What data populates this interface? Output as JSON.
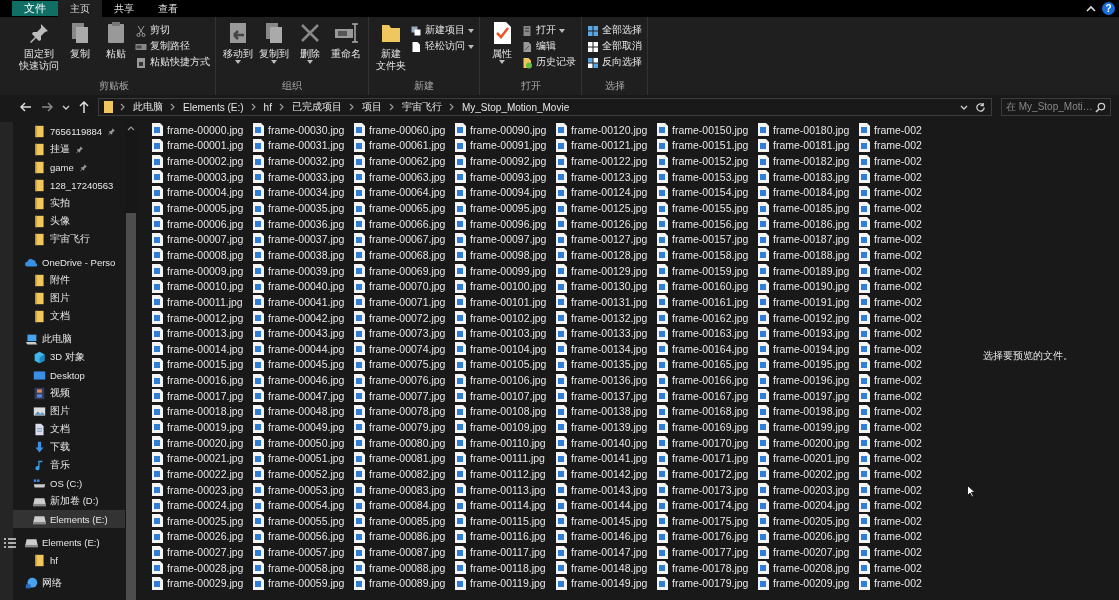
{
  "tabs": [
    {
      "label": "文件",
      "kind": "file",
      "selected": false
    },
    {
      "label": "主页",
      "kind": "tab",
      "selected": true
    },
    {
      "label": "共享",
      "kind": "tab",
      "selected": false
    },
    {
      "label": "查看",
      "kind": "tab",
      "selected": false
    }
  ],
  "help_button": "?",
  "ribbon": {
    "groups": [
      {
        "label": "剪贴板",
        "large": [
          {
            "kind": "pin",
            "lines": [
              "固定到",
              "快速访问"
            ],
            "dropdown": false
          },
          {
            "kind": "copy",
            "lines": [
              "复制"
            ],
            "dropdown": false
          },
          {
            "kind": "paste",
            "lines": [
              "粘贴"
            ],
            "dropdown": false
          }
        ],
        "small": [
          {
            "kind": "cut",
            "label": "剪切",
            "dropdown": false
          },
          {
            "kind": "copy-path",
            "label": "复制路径",
            "dropdown": false
          },
          {
            "kind": "paste-shortcut",
            "label": "粘贴快捷方式",
            "dropdown": false
          }
        ]
      },
      {
        "label": "组织",
        "large": [
          {
            "kind": "move-to",
            "lines": [
              "移动到"
            ],
            "dropdown": true
          },
          {
            "kind": "copy-to",
            "lines": [
              "复制到"
            ],
            "dropdown": true
          },
          {
            "kind": "delete",
            "lines": [
              "删除"
            ],
            "dropdown": true
          },
          {
            "kind": "rename",
            "lines": [
              "重命名"
            ],
            "dropdown": false
          }
        ]
      },
      {
        "label": "新建",
        "large": [
          {
            "kind": "new-folder",
            "lines": [
              "新建",
              "文件夹"
            ],
            "dropdown": false
          }
        ],
        "small": [
          {
            "kind": "new-item",
            "label": "新建项目",
            "dropdown": true
          },
          {
            "kind": "easy-access",
            "label": "轻松访问",
            "dropdown": true
          }
        ]
      },
      {
        "label": "打开",
        "large": [
          {
            "kind": "properties",
            "lines": [
              "属性"
            ],
            "dropdown": true
          }
        ],
        "small": [
          {
            "kind": "open",
            "label": "打开",
            "dropdown": true
          },
          {
            "kind": "edit",
            "label": "编辑",
            "dropdown": false
          },
          {
            "kind": "history",
            "label": "历史记录",
            "dropdown": false
          }
        ]
      },
      {
        "label": "选择",
        "small": [
          {
            "kind": "select-all",
            "label": "全部选择",
            "dropdown": false
          },
          {
            "kind": "select-none",
            "label": "全部取消",
            "dropdown": false
          },
          {
            "kind": "invert",
            "label": "反向选择",
            "dropdown": false
          }
        ]
      }
    ]
  },
  "address_bar": {
    "path": [
      "此电脑",
      "Elements (E:)",
      "hf",
      "已完成项目",
      "项目",
      "宇宙飞行",
      "My_Stop_Motion_Movie"
    ],
    "search_placeholder": "在 My_Stop_Moti…"
  },
  "sidebar": {
    "quick_access_items": [
      {
        "label": "7656119884",
        "kind": "folder",
        "pinned": true,
        "selected": false
      },
      {
        "label": "挂逼",
        "kind": "folder",
        "pinned": true,
        "selected": false
      },
      {
        "label": "game",
        "kind": "folder",
        "pinned": true,
        "selected": false
      },
      {
        "label": "128_17240563",
        "kind": "folder",
        "pinned": false,
        "selected": false
      },
      {
        "label": "实拍",
        "kind": "folder",
        "pinned": false,
        "selected": false
      },
      {
        "label": "头像",
        "kind": "folder",
        "pinned": false,
        "selected": false
      },
      {
        "label": "宇宙飞行",
        "kind": "folder",
        "pinned": false,
        "selected": false
      }
    ],
    "tree": [
      {
        "label": "OneDrive - Perso",
        "kind": "cloud",
        "selected": false,
        "children": [
          {
            "label": "附件",
            "kind": "folder",
            "selected": false
          },
          {
            "label": "图片",
            "kind": "folder",
            "selected": false
          },
          {
            "label": "文档",
            "kind": "folder",
            "selected": false
          }
        ]
      },
      {
        "label": "此电脑",
        "kind": "pc",
        "selected": false,
        "children": [
          {
            "label": "3D 对象",
            "kind": "cube",
            "selected": false
          },
          {
            "label": "Desktop",
            "kind": "desktop",
            "selected": false
          },
          {
            "label": "视频",
            "kind": "video",
            "selected": false
          },
          {
            "label": "图片",
            "kind": "pictures",
            "selected": false
          },
          {
            "label": "文档",
            "kind": "document",
            "selected": false
          },
          {
            "label": "下载",
            "kind": "download",
            "selected": false
          },
          {
            "label": "音乐",
            "kind": "music",
            "selected": false
          },
          {
            "label": "OS (C:)",
            "kind": "os-drive",
            "selected": false
          },
          {
            "label": "新加卷 (D:)",
            "kind": "drive",
            "selected": false
          },
          {
            "label": "Elements (E:)",
            "kind": "drive",
            "selected": true
          }
        ]
      },
      {
        "label": "Elements (E:)",
        "kind": "drive",
        "selected": false,
        "children": [
          {
            "label": "hf",
            "kind": "folder",
            "selected": false
          }
        ]
      },
      {
        "label": "网络",
        "kind": "network",
        "selected": false
      }
    ]
  },
  "file_columns": [
    [
      "frame-00000.jpg",
      "frame-00001.jpg",
      "frame-00002.jpg",
      "frame-00003.jpg",
      "frame-00004.jpg",
      "frame-00005.jpg",
      "frame-00006.jpg",
      "frame-00007.jpg",
      "frame-00008.jpg",
      "frame-00009.jpg",
      "frame-00010.jpg",
      "frame-00011.jpg",
      "frame-00012.jpg",
      "frame-00013.jpg",
      "frame-00014.jpg",
      "frame-00015.jpg",
      "frame-00016.jpg",
      "frame-00017.jpg",
      "frame-00018.jpg",
      "frame-00019.jpg",
      "frame-00020.jpg",
      "frame-00021.jpg",
      "frame-00022.jpg",
      "frame-00023.jpg",
      "frame-00024.jpg",
      "frame-00025.jpg",
      "frame-00026.jpg",
      "frame-00027.jpg",
      "frame-00028.jpg",
      "frame-00029.jpg"
    ],
    [
      "frame-00030.jpg",
      "frame-00031.jpg",
      "frame-00032.jpg",
      "frame-00033.jpg",
      "frame-00034.jpg",
      "frame-00035.jpg",
      "frame-00036.jpg",
      "frame-00037.jpg",
      "frame-00038.jpg",
      "frame-00039.jpg",
      "frame-00040.jpg",
      "frame-00041.jpg",
      "frame-00042.jpg",
      "frame-00043.jpg",
      "frame-00044.jpg",
      "frame-00045.jpg",
      "frame-00046.jpg",
      "frame-00047.jpg",
      "frame-00048.jpg",
      "frame-00049.jpg",
      "frame-00050.jpg",
      "frame-00051.jpg",
      "frame-00052.jpg",
      "frame-00053.jpg",
      "frame-00054.jpg",
      "frame-00055.jpg",
      "frame-00056.jpg",
      "frame-00057.jpg",
      "frame-00058.jpg",
      "frame-00059.jpg"
    ],
    [
      "frame-00060.jpg",
      "frame-00061.jpg",
      "frame-00062.jpg",
      "frame-00063.jpg",
      "frame-00064.jpg",
      "frame-00065.jpg",
      "frame-00066.jpg",
      "frame-00067.jpg",
      "frame-00068.jpg",
      "frame-00069.jpg",
      "frame-00070.jpg",
      "frame-00071.jpg",
      "frame-00072.jpg",
      "frame-00073.jpg",
      "frame-00074.jpg",
      "frame-00075.jpg",
      "frame-00076.jpg",
      "frame-00077.jpg",
      "frame-00078.jpg",
      "frame-00079.jpg",
      "frame-00080.jpg",
      "frame-00081.jpg",
      "frame-00082.jpg",
      "frame-00083.jpg",
      "frame-00084.jpg",
      "frame-00085.jpg",
      "frame-00086.jpg",
      "frame-00087.jpg",
      "frame-00088.jpg",
      "frame-00089.jpg"
    ],
    [
      "frame-00090.jpg",
      "frame-00091.jpg",
      "frame-00092.jpg",
      "frame-00093.jpg",
      "frame-00094.jpg",
      "frame-00095.jpg",
      "frame-00096.jpg",
      "frame-00097.jpg",
      "frame-00098.jpg",
      "frame-00099.jpg",
      "frame-00100.jpg",
      "frame-00101.jpg",
      "frame-00102.jpg",
      "frame-00103.jpg",
      "frame-00104.jpg",
      "frame-00105.jpg",
      "frame-00106.jpg",
      "frame-00107.jpg",
      "frame-00108.jpg",
      "frame-00109.jpg",
      "frame-00110.jpg",
      "frame-00111.jpg",
      "frame-00112.jpg",
      "frame-00113.jpg",
      "frame-00114.jpg",
      "frame-00115.jpg",
      "frame-00116.jpg",
      "frame-00117.jpg",
      "frame-00118.jpg",
      "frame-00119.jpg"
    ],
    [
      "frame-00120.jpg",
      "frame-00121.jpg",
      "frame-00122.jpg",
      "frame-00123.jpg",
      "frame-00124.jpg",
      "frame-00125.jpg",
      "frame-00126.jpg",
      "frame-00127.jpg",
      "frame-00128.jpg",
      "frame-00129.jpg",
      "frame-00130.jpg",
      "frame-00131.jpg",
      "frame-00132.jpg",
      "frame-00133.jpg",
      "frame-00134.jpg",
      "frame-00135.jpg",
      "frame-00136.jpg",
      "frame-00137.jpg",
      "frame-00138.jpg",
      "frame-00139.jpg",
      "frame-00140.jpg",
      "frame-00141.jpg",
      "frame-00142.jpg",
      "frame-00143.jpg",
      "frame-00144.jpg",
      "frame-00145.jpg",
      "frame-00146.jpg",
      "frame-00147.jpg",
      "frame-00148.jpg",
      "frame-00149.jpg"
    ],
    [
      "frame-00150.jpg",
      "frame-00151.jpg",
      "frame-00152.jpg",
      "frame-00153.jpg",
      "frame-00154.jpg",
      "frame-00155.jpg",
      "frame-00156.jpg",
      "frame-00157.jpg",
      "frame-00158.jpg",
      "frame-00159.jpg",
      "frame-00160.jpg",
      "frame-00161.jpg",
      "frame-00162.jpg",
      "frame-00163.jpg",
      "frame-00164.jpg",
      "frame-00165.jpg",
      "frame-00166.jpg",
      "frame-00167.jpg",
      "frame-00168.jpg",
      "frame-00169.jpg",
      "frame-00170.jpg",
      "frame-00171.jpg",
      "frame-00172.jpg",
      "frame-00173.jpg",
      "frame-00174.jpg",
      "frame-00175.jpg",
      "frame-00176.jpg",
      "frame-00177.jpg",
      "frame-00178.jpg",
      "frame-00179.jpg"
    ],
    [
      "frame-00180.jpg",
      "frame-00181.jpg",
      "frame-00182.jpg",
      "frame-00183.jpg",
      "frame-00184.jpg",
      "frame-00185.jpg",
      "frame-00186.jpg",
      "frame-00187.jpg",
      "frame-00188.jpg",
      "frame-00189.jpg",
      "frame-00190.jpg",
      "frame-00191.jpg",
      "frame-00192.jpg",
      "frame-00193.jpg",
      "frame-00194.jpg",
      "frame-00195.jpg",
      "frame-00196.jpg",
      "frame-00197.jpg",
      "frame-00198.jpg",
      "frame-00199.jpg",
      "frame-00200.jpg",
      "frame-00201.jpg",
      "frame-00202.jpg",
      "frame-00203.jpg",
      "frame-00204.jpg",
      "frame-00205.jpg",
      "frame-00206.jpg",
      "frame-00207.jpg",
      "frame-00208.jpg",
      "frame-00209.jpg"
    ],
    [
      "frame-002",
      "frame-002",
      "frame-002",
      "frame-002",
      "frame-002",
      "frame-002",
      "frame-002",
      "frame-002",
      "frame-002",
      "frame-002",
      "frame-002",
      "frame-002",
      "frame-002",
      "frame-002",
      "frame-002",
      "frame-002",
      "frame-002",
      "frame-002",
      "frame-002",
      "frame-002",
      "frame-002",
      "frame-002",
      "frame-002",
      "frame-002",
      "frame-002",
      "frame-002",
      "frame-002",
      "frame-002",
      "frame-002",
      "frame-002"
    ]
  ],
  "preview_pane": {
    "message": "选择要预览的文件。"
  }
}
